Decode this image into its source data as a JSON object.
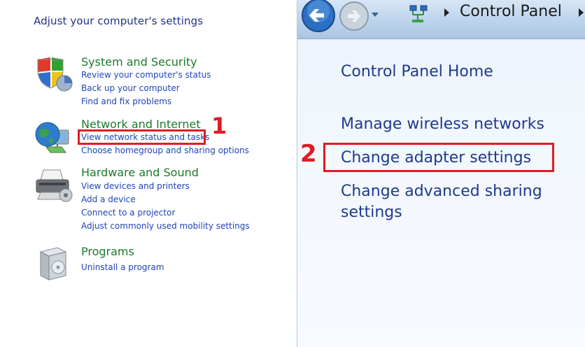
{
  "left": {
    "heading": "Adjust your computer's settings",
    "categories": [
      {
        "title": "System and Security",
        "icon": "shield-icon",
        "links": [
          "Review your computer's status",
          "Back up your computer",
          "Find and fix problems"
        ]
      },
      {
        "title": "Network and Internet",
        "icon": "globe-network-icon",
        "links": [
          "View network status and tasks",
          "Choose homegroup and sharing options"
        ]
      },
      {
        "title": "Hardware and Sound",
        "icon": "printer-icon",
        "links": [
          "View devices and printers",
          "Add a device",
          "Connect to a projector",
          "Adjust commonly used mobility settings"
        ]
      },
      {
        "title": "Programs",
        "icon": "programs-box-icon",
        "links": [
          "Uninstall a program"
        ]
      }
    ]
  },
  "right": {
    "breadcrumb": "Control Panel",
    "links": [
      "Control Panel Home",
      "Manage wireless networks",
      "Change adapter settings",
      "Change advanced sharing",
      "settings"
    ]
  },
  "annotations": {
    "step1": "1",
    "step2": "2"
  },
  "colors": {
    "category_title": "#1b7a2b",
    "link": "#1f44b8",
    "heading": "#1e3287",
    "annotation": "#e01b24",
    "right_link": "#1e3a8c"
  }
}
